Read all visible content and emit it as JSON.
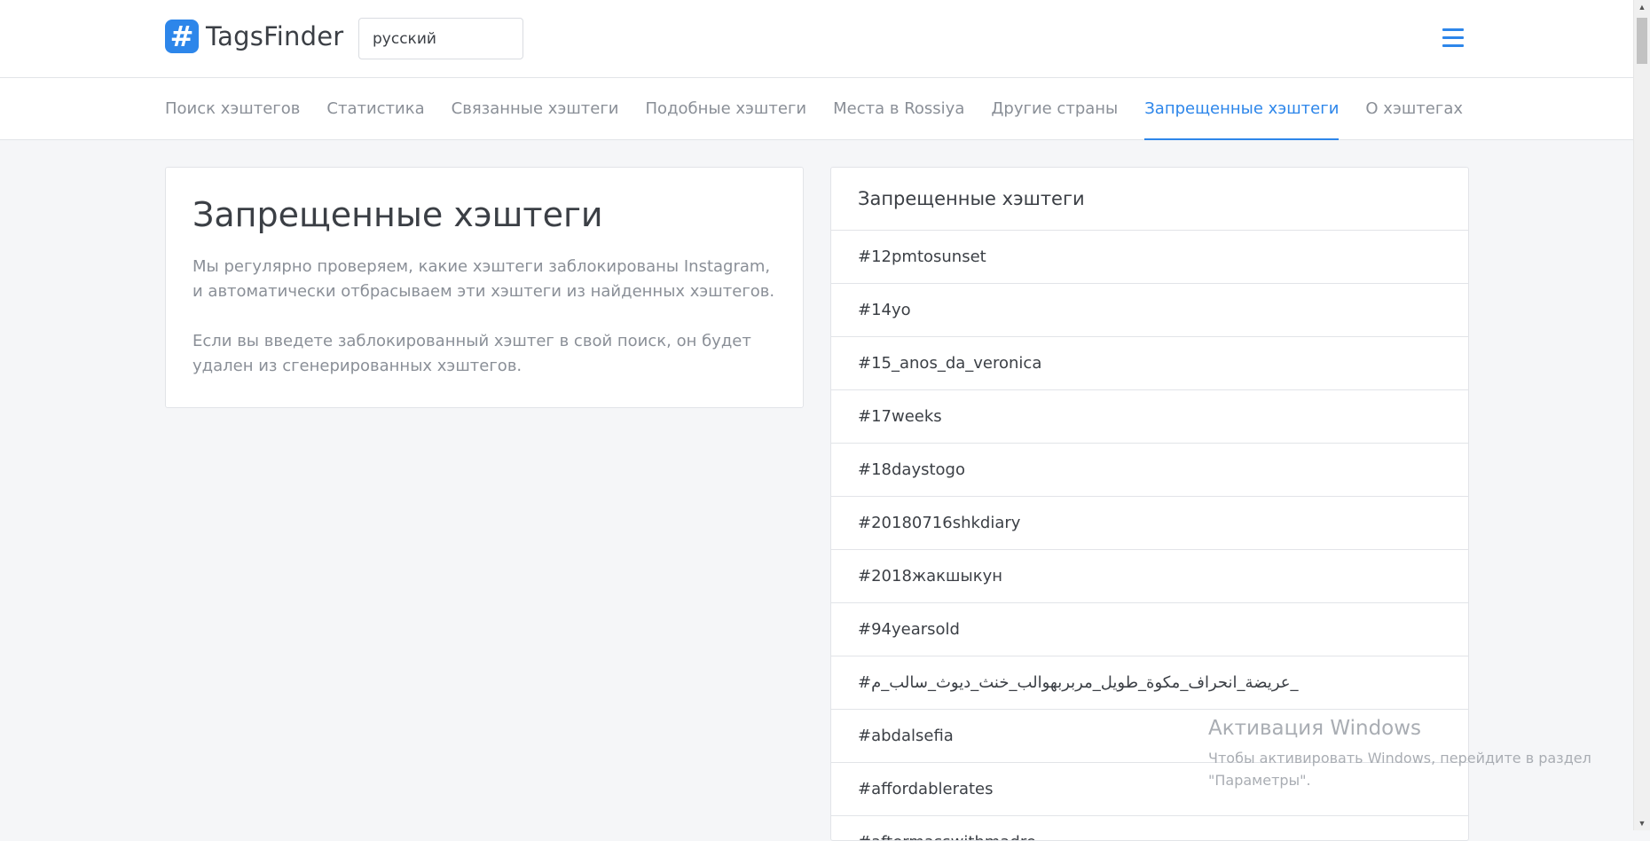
{
  "header": {
    "logo_symbol": "#",
    "logo_text": "TagsFinder",
    "search_value": "русский",
    "brand_color": "#2d86ea"
  },
  "nav": {
    "tabs": [
      {
        "label": "Поиск хэштегов"
      },
      {
        "label": "Статистика"
      },
      {
        "label": "Связанные хэштеги"
      },
      {
        "label": "Подобные хэштеги"
      },
      {
        "label": "Места в Rossiya"
      },
      {
        "label": "Другие страны"
      },
      {
        "label": "Запрещенные хэштеги",
        "active": true
      },
      {
        "label": "О хэштегах"
      }
    ]
  },
  "info": {
    "title": "Запрещенные хэштеги",
    "paragraph1": "Мы регулярно проверяем, какие хэштеги заблокированы Instagram, и автоматически отбрасываем эти хэштеги из найденных хэштегов.",
    "paragraph2": "Если вы введете заблокированный хэштег в свой поиск, он будет удален из сгенерированных хэштегов."
  },
  "banned": {
    "title": "Запрещенные хэштеги",
    "tags": [
      "#12pmtosunset",
      "#14yo",
      "#15_anos_da_veronica",
      "#17weeks",
      "#18daystogo",
      "#20180716shkdiary",
      "#2018жакшыкун",
      "#94yearsold",
      "#عريضة_انحراف_مكوة_طويل_مربربهوالب_خنث_ديوث_سالب_م_",
      "#abdalsefia",
      "#affordablerates",
      "#aftermasswithmadre"
    ]
  },
  "watermark": {
    "title": "Активация Windows",
    "line1": "Чтобы активировать Windows, перейдите в раздел",
    "line2": "\"Параметры\"."
  }
}
